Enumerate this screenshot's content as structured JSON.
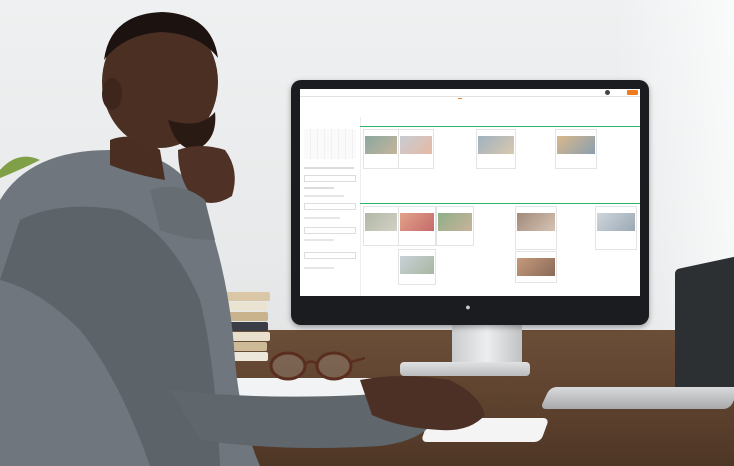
{
  "app": {
    "brand": "",
    "user_name": "",
    "create_label": ""
  },
  "calendar": {
    "tabs": [
      {
        "label": "",
        "active": false
      },
      {
        "label": "",
        "active": true
      },
      {
        "label": "",
        "active": false
      }
    ],
    "date_range": "",
    "mini_month": "",
    "days": [
      "",
      "",
      "",
      "",
      "",
      "",
      ""
    ],
    "sections": [
      "",
      ""
    ]
  },
  "colors": {
    "accent": "#f27a1a",
    "timeline": "#2fb56a",
    "link_blue": "#4a7fbf"
  }
}
